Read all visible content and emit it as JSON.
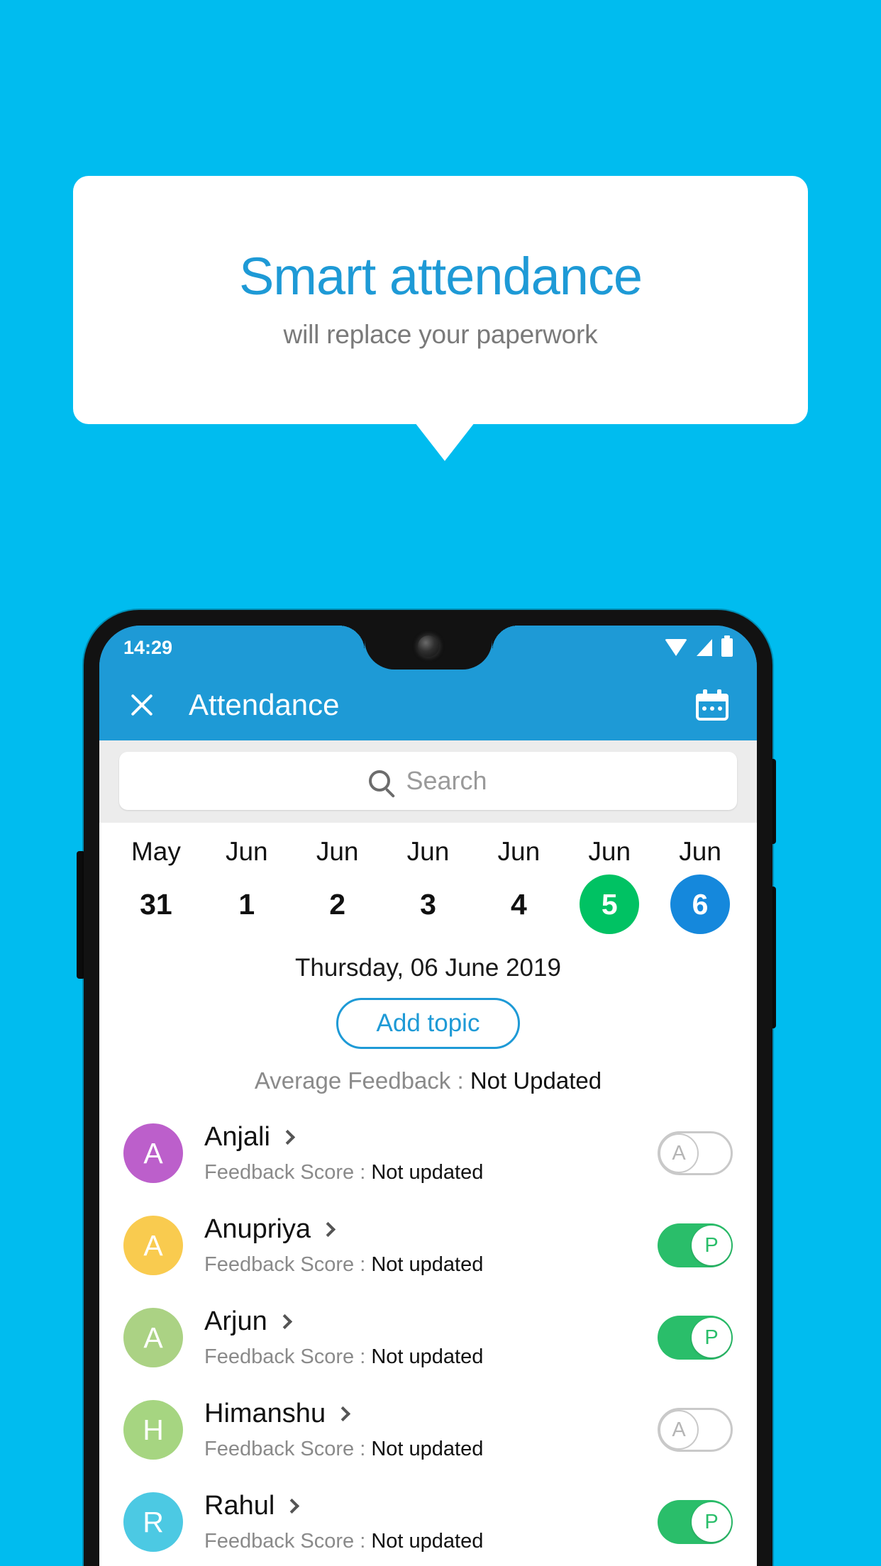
{
  "promo": {
    "title": "Smart attendance",
    "subtitle": "will replace your paperwork"
  },
  "colors": {
    "background": "#00BCEF",
    "accent": "#1e9ad6",
    "present_green": "#2ABE6A",
    "selected_green": "#00C263",
    "selected_blue": "#1588DC"
  },
  "phone": {
    "statusbar": {
      "time": "14:29",
      "icons": [
        "wifi-icon",
        "signal-icon",
        "battery-icon"
      ]
    },
    "appbar": {
      "close_icon": "close-icon",
      "title": "Attendance",
      "calendar_icon": "calendar-icon"
    },
    "search": {
      "icon": "search-icon",
      "placeholder": "Search",
      "value": ""
    },
    "datestrip": [
      {
        "month": "May",
        "day": "31",
        "state": "normal"
      },
      {
        "month": "Jun",
        "day": "1",
        "state": "normal"
      },
      {
        "month": "Jun",
        "day": "2",
        "state": "normal"
      },
      {
        "month": "Jun",
        "day": "3",
        "state": "normal"
      },
      {
        "month": "Jun",
        "day": "4",
        "state": "normal"
      },
      {
        "month": "Jun",
        "day": "5",
        "state": "green"
      },
      {
        "month": "Jun",
        "day": "6",
        "state": "blue"
      }
    ],
    "date_title": "Thursday, 06 June 2019",
    "add_topic_label": "Add topic",
    "average_feedback": {
      "label": "Average Feedback : ",
      "value": "Not Updated"
    },
    "students": [
      {
        "name": "Anjali",
        "initial": "A",
        "avatar_color": "#BC5FCB",
        "feedback_label": "Feedback Score : ",
        "feedback_value": "Not updated",
        "attendance": "A",
        "present": false
      },
      {
        "name": "Anupriya",
        "initial": "A",
        "avatar_color": "#F9CB4F",
        "feedback_label": "Feedback Score : ",
        "feedback_value": "Not updated",
        "attendance": "P",
        "present": true
      },
      {
        "name": "Arjun",
        "initial": "A",
        "avatar_color": "#ABD284",
        "feedback_label": "Feedback Score : ",
        "feedback_value": "Not updated",
        "attendance": "P",
        "present": true
      },
      {
        "name": "Himanshu",
        "initial": "H",
        "avatar_color": "#A6D581",
        "feedback_label": "Feedback Score : ",
        "feedback_value": "Not updated",
        "attendance": "A",
        "present": false
      },
      {
        "name": "Rahul",
        "initial": "R",
        "avatar_color": "#4CC9E3",
        "feedback_label": "Feedback Score : ",
        "feedback_value": "Not updated",
        "attendance": "P",
        "present": true
      }
    ]
  }
}
